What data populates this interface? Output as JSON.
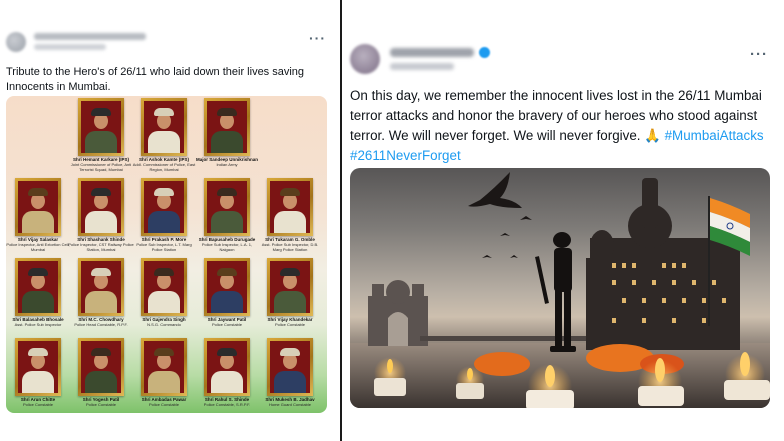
{
  "left_post": {
    "more_icon": "···",
    "text": "Tribute to the Hero's of 26/11 who laid down their lives saving Innocents in Mumbai.",
    "portraits": [
      {
        "name": "Shri Hemant Karkare (IPS)",
        "title": "Joint Commissioner of Police, Anti Terrorist Squad, Mumbai"
      },
      {
        "name": "Shri Ashok Kamte (IPS)",
        "title": "Addl. Commissioner of Police, East Region, Mumbai"
      },
      {
        "name": "Major Sandeep Unnikrishnan",
        "title": "Indian Army"
      },
      {
        "name": "Shri Vijay Salaskar",
        "title": "Police Inspector, Anti Extortion Cell, Mumbai"
      },
      {
        "name": "Shri Shashank Shinde",
        "title": "Police Inspector, CST Railway Police Station, Mumbai"
      },
      {
        "name": "Shri Prakash P. More",
        "title": "Police Sub Inspector, L.T. Marg Police Station"
      },
      {
        "name": "Shri Bapusaheb Durugade",
        "title": "Police Sub Inspector, L.A. 1, Naigaon"
      },
      {
        "name": "Shri Tukaram G. Omble",
        "title": "Asst. Police Sub Inspector, D.B. Marg Police Station"
      },
      {
        "name": "Shri Balasaheb Bhosale",
        "title": "Asst. Police Sub Inspector"
      },
      {
        "name": "Shri M.C. Chowdhary",
        "title": "Police Head Constable, R.P.F."
      },
      {
        "name": "Shri Gajendra Singh",
        "title": "N.S.G. Commando"
      },
      {
        "name": "Shri Jaywant Patil",
        "title": "Police Constable"
      },
      {
        "name": "Shri Vijay Khandekar",
        "title": "Police Constable"
      },
      {
        "name": "Shri Arun Chitte",
        "title": "Police Constable"
      },
      {
        "name": "Shri Yogesh Patil",
        "title": "Police Constable"
      },
      {
        "name": "Shri Ambadas Pawar",
        "title": "Police Constable"
      },
      {
        "name": "Shri Rahul S. Shinde",
        "title": "Police Constable, S.R.P.F."
      },
      {
        "name": "Shri Mukesh B. Jadhav",
        "title": "Home Guard Constable"
      }
    ]
  },
  "right_post": {
    "more_icon": "···",
    "text_main": "On this day, we remember the innocent lives lost in the 26/11 Mumbai terror attacks and honor the bravery of our heroes who stood against terror. We will never forget. We will never forgive. 🙏 ",
    "hashtags": [
      "#MumbaiAttacks",
      "#2611NeverForget"
    ]
  },
  "colors": {
    "hashtag": "#1d9bf0",
    "frame_gold": "#c9962e",
    "portrait_bg": "#7b1414",
    "divider": "#1a1a1a"
  }
}
